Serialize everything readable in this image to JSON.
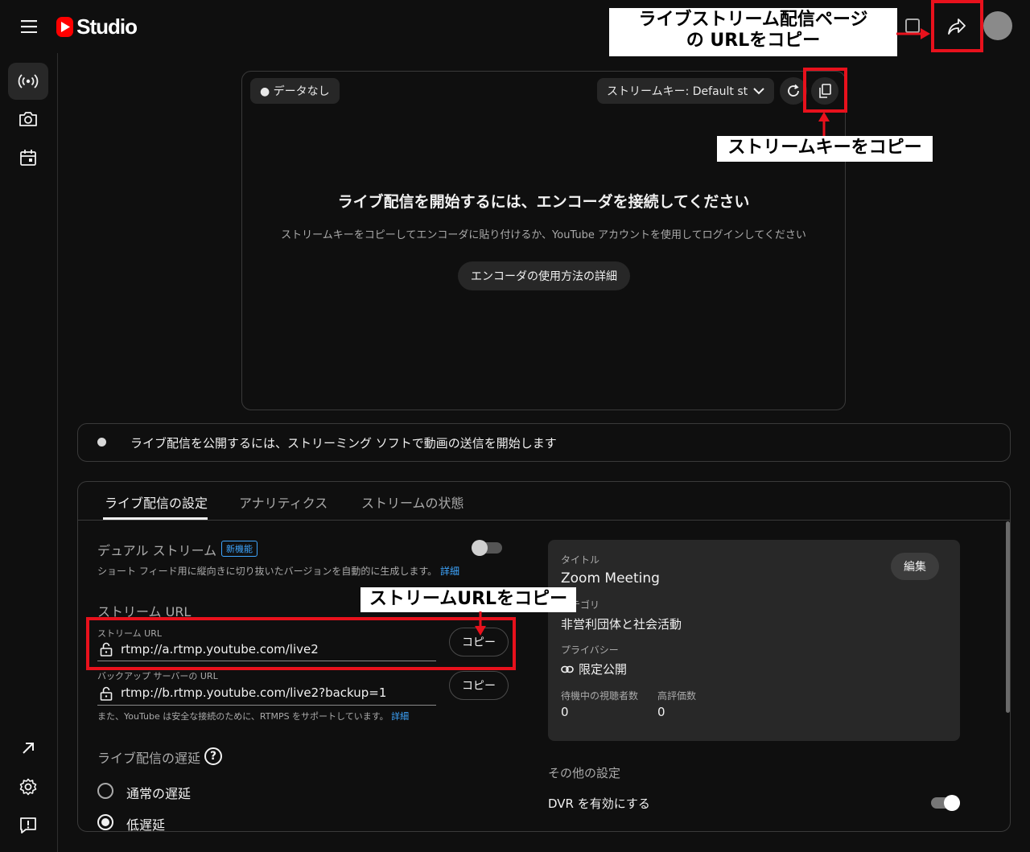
{
  "header": {
    "brand": "Studio"
  },
  "annotations": {
    "copy_page_url": "ライブストリーム配信ページの URLをコピー",
    "copy_stream_key": "ストリームキーをコピー",
    "copy_stream_url": "ストリームURLをコピー"
  },
  "preview": {
    "status": "● データなし",
    "stream_key_label": "ストリームキー: Default stre",
    "heading": "ライブ配信を開始するには、エンコーダを接続してください",
    "subtext": "ストリームキーをコピーしてエンコーダに貼り付けるか、YouTube アカウントを使用してログインしてください",
    "encoder_button": "エンコーダの使用方法の詳細"
  },
  "notice": {
    "text": "ライブ配信を公開するには、ストリーミング ソフトで動画の送信を開始します"
  },
  "tabs": [
    {
      "label": "ライブ配信の設定"
    },
    {
      "label": "アナリティクス"
    },
    {
      "label": "ストリームの状態"
    }
  ],
  "settings": {
    "dual_stream_label": "デュアル ストリーム",
    "new_badge": "新機能",
    "dual_stream_desc": "ショート フィード用に縦向きに切り抜いたバージョンを自動的に生成します。",
    "details_link": "詳細",
    "stream_url_heading": "ストリーム URL",
    "stream_url_field_label": "ストリーム URL",
    "stream_url_value": "rtmp://a.rtmp.youtube.com/live2",
    "copy_label": "コピー",
    "backup_field_label": "バックアップ サーバーの URL",
    "backup_value": "rtmp://b.rtmp.youtube.com/live2?backup=1",
    "rtmps_note": "また、YouTube は安全な接続のために、RTMPS をサポートしています。",
    "latency_heading": "ライブ配信の遅延",
    "latency_options": [
      {
        "label": "通常の遅延",
        "selected": false
      },
      {
        "label": "低遅延",
        "selected": true
      }
    ]
  },
  "info_card": {
    "title_label": "タイトル",
    "title_value": "Zoom Meeting",
    "edit_label": "編集",
    "category_label": "カテゴリ",
    "category_value": "非営利団体と社会活動",
    "privacy_label": "プライバシー",
    "privacy_value": "限定公開",
    "waiting_viewers_label": "待機中の視聴者数",
    "waiting_viewers_value": "0",
    "likes_label": "高評価数",
    "likes_value": "0"
  },
  "other_settings": {
    "heading": "その他の設定",
    "dvr_label": "DVR を有効にする",
    "dvr_enabled": true
  },
  "colors": {
    "annotation_red": "#e8111c",
    "brand_red": "#ff0000",
    "link_blue": "#3ea6ff"
  }
}
